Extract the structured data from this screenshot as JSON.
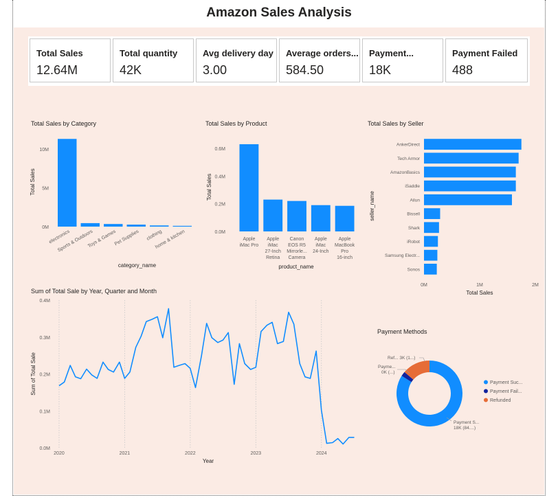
{
  "page_title": "Amazon Sales Analysis",
  "kpis": [
    {
      "label": "Total Sales",
      "value": "12.64M"
    },
    {
      "label": "Total quantity",
      "value": "42K"
    },
    {
      "label": "Avg delivery day",
      "value": "3.00"
    },
    {
      "label": "Average orders...",
      "value": "584.50"
    },
    {
      "label": "Payment...",
      "value": "18K"
    },
    {
      "label": "Payment Failed",
      "value": "488"
    }
  ],
  "colors": {
    "primary": "#118dff",
    "dark_blue": "#12239e",
    "orange": "#e66c37",
    "background": "#fbebe4"
  },
  "chart_data": [
    {
      "type": "bar",
      "title": "Total Sales by Category",
      "xlabel": "category_name",
      "ylabel": "Total Sales",
      "categories": [
        "electronics",
        "Sports & Outdoors",
        "Toys & Games",
        "Pet Supplies",
        "clothing",
        "home & kitchen"
      ],
      "values": [
        11300000,
        450000,
        340000,
        260000,
        150000,
        100000
      ],
      "ylim": [
        0,
        11500000
      ],
      "yticks": [
        {
          "v": 0,
          "label": "0M"
        },
        {
          "v": 5000000,
          "label": "5M"
        },
        {
          "v": 10000000,
          "label": "10M"
        }
      ]
    },
    {
      "type": "bar",
      "title": "Total Sales by Product",
      "xlabel": "product_name",
      "ylabel": "Total Sales",
      "categories": [
        [
          "Apple",
          "iMac Pro"
        ],
        [
          "Apple",
          "iMac",
          "27-Inch",
          "Retina"
        ],
        [
          "Canon",
          "EOS R5",
          "Mirrorle...",
          "Camera"
        ],
        [
          "Apple",
          "iMac",
          "24-Inch"
        ],
        [
          "Apple",
          "MacBook",
          "Pro",
          "16-inch"
        ]
      ],
      "values": [
        630000,
        230000,
        220000,
        190000,
        185000
      ],
      "ylim": [
        0,
        640000
      ],
      "yticks": [
        {
          "v": 0,
          "label": "0.0M"
        },
        {
          "v": 200000,
          "label": "0.2M"
        },
        {
          "v": 400000,
          "label": "0.4M"
        },
        {
          "v": 600000,
          "label": "0.6M"
        }
      ]
    },
    {
      "type": "bar",
      "orientation": "horizontal",
      "title": "Total Sales by Seller",
      "xlabel": "Total Sales",
      "ylabel": "seller_name",
      "categories": [
        "AnkerDirect",
        "Tech Armor",
        "AmazonBasics",
        "iSaddle",
        "Ailun",
        "Bissell",
        "Shark",
        "iRobot",
        "Samsung Electr...",
        "Sonos"
      ],
      "values": [
        1750000,
        1700000,
        1650000,
        1650000,
        1580000,
        290000,
        270000,
        250000,
        240000,
        230000
      ],
      "xlim": [
        0,
        2000000
      ],
      "xticks": [
        {
          "v": 0,
          "label": "0M"
        },
        {
          "v": 1000000,
          "label": "1M"
        },
        {
          "v": 2000000,
          "label": "2M"
        }
      ]
    },
    {
      "type": "line",
      "title": "Sum of Total Sale by Year, Quarter and Month",
      "xlabel": "Year",
      "ylabel": "Sum of Total Sale",
      "x": [
        2020.0,
        2020.08,
        2020.17,
        2020.25,
        2020.33,
        2020.42,
        2020.5,
        2020.58,
        2020.67,
        2020.75,
        2020.83,
        2020.92,
        2021.0,
        2021.08,
        2021.17,
        2021.25,
        2021.33,
        2021.42,
        2021.5,
        2021.58,
        2021.67,
        2021.75,
        2021.83,
        2021.92,
        2022.0,
        2022.08,
        2022.17,
        2022.25,
        2022.33,
        2022.42,
        2022.5,
        2022.58,
        2022.67,
        2022.75,
        2022.83,
        2022.92,
        2023.0,
        2023.08,
        2023.17,
        2023.25,
        2023.33,
        2023.42,
        2023.5,
        2023.58,
        2023.67,
        2023.75,
        2023.83,
        2023.92,
        2024.0,
        2024.08,
        2024.17,
        2024.25,
        2024.33,
        2024.42,
        2024.5
      ],
      "y": [
        168000,
        178000,
        223000,
        192000,
        187000,
        213000,
        197000,
        188000,
        232000,
        212000,
        205000,
        232000,
        188000,
        205000,
        272000,
        302000,
        342000,
        348000,
        355000,
        298000,
        377000,
        218000,
        223000,
        228000,
        215000,
        163000,
        248000,
        337000,
        298000,
        285000,
        292000,
        312000,
        172000,
        282000,
        228000,
        212000,
        218000,
        315000,
        332000,
        340000,
        282000,
        288000,
        367000,
        335000,
        228000,
        192000,
        188000,
        262000,
        102000,
        12000,
        14000,
        25000,
        10000,
        28000,
        28000
      ],
      "ylim": [
        0,
        400000
      ],
      "yticks": [
        {
          "v": 0,
          "label": "0.0M"
        },
        {
          "v": 100000,
          "label": "0.1M"
        },
        {
          "v": 200000,
          "label": "0.2M"
        },
        {
          "v": 300000,
          "label": "0.3M"
        },
        {
          "v": 400000,
          "label": "0.4M"
        }
      ],
      "xticks": [
        {
          "v": 2020,
          "label": "2020"
        },
        {
          "v": 2021,
          "label": "2021"
        },
        {
          "v": 2022,
          "label": "2022"
        },
        {
          "v": 2023,
          "label": "2023"
        },
        {
          "v": 2024,
          "label": "2024"
        }
      ],
      "xlim": [
        2019.99,
        2024.6
      ]
    },
    {
      "type": "pie",
      "donut": true,
      "title": "Payment Methods",
      "slices": [
        {
          "name": "Payment Suc...",
          "value": 84,
          "color": "#118dff",
          "label": [
            "Payment S...",
            "18K (84....)"
          ]
        },
        {
          "name": "Payment Fail...",
          "value": 2.3,
          "color": "#12239e",
          "label": [
            "Payme...",
            "0K (...)"
          ]
        },
        {
          "name": "Refunded",
          "value": 13.7,
          "color": "#e66c37",
          "label": [
            "Ref... 3K (1...)"
          ]
        }
      ]
    }
  ]
}
